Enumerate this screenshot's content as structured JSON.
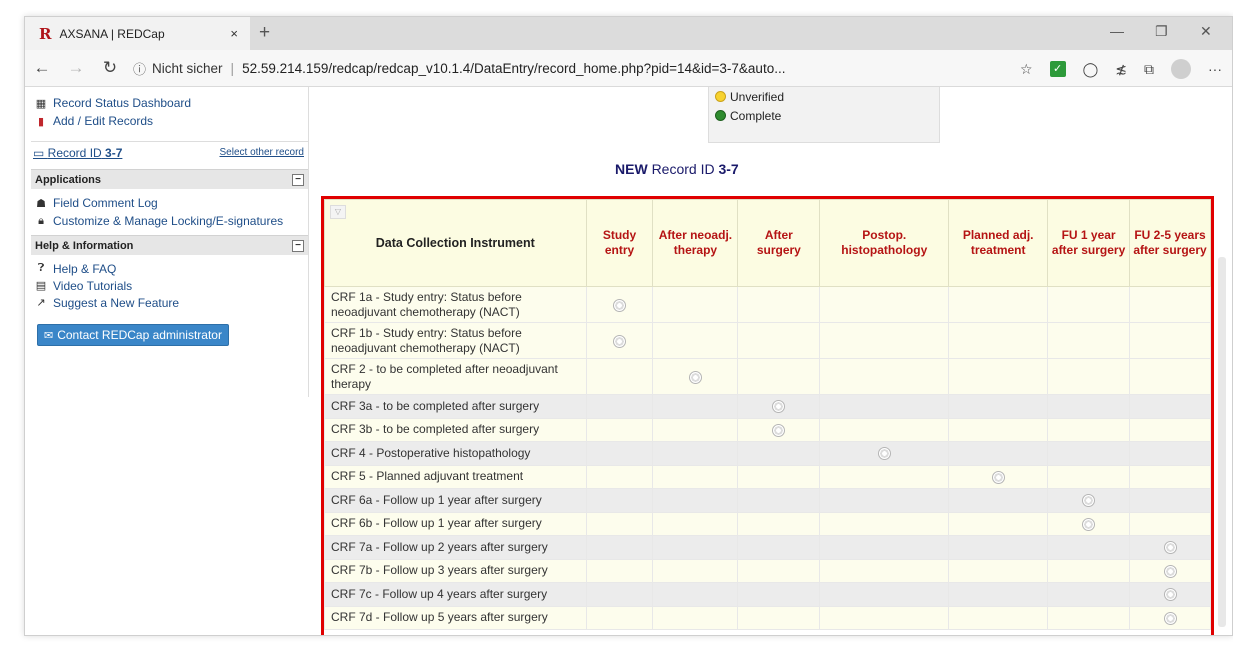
{
  "browser": {
    "tab_logo": "R",
    "tab_title": "AXSANA | REDCap",
    "tab_close": "×",
    "new_tab": "+",
    "insecure_label": "Nicht sicher",
    "url": "52.59.214.159/redcap/redcap_v10.1.4/DataEntry/record_home.php?pid=14&id=3-7&auto..."
  },
  "sidebar": {
    "dashboard": "Record Status Dashboard",
    "add_edit": "Add / Edit Records",
    "record_label": "Record ID",
    "record_id": "3-7",
    "select_other": "Select other record",
    "applications": {
      "header": "Applications",
      "items": [
        "Field Comment Log",
        "Customize & Manage Locking/E-signatures"
      ]
    },
    "help": {
      "header": "Help & Information",
      "items": [
        "Help & FAQ",
        "Video Tutorials",
        "Suggest a New Feature"
      ]
    },
    "contact_button": "Contact REDCap administrator"
  },
  "legend": {
    "unverified": "Unverified",
    "complete": "Complete"
  },
  "record_title": {
    "prefix": "NEW",
    "label": "Record ID",
    "id": "3-7"
  },
  "grid": {
    "instrument_header": "Data Collection Instrument",
    "events": [
      "Study entry",
      "After neoadj. therapy",
      "After surgery",
      "Postop. histopathology",
      "Planned adj. treatment",
      "FU 1 year after surgery",
      "FU 2-5 years after surgery"
    ],
    "rows": [
      {
        "name": "CRF 1a - Study entry: Status before neoadjuvant chemotherapy (NACT)",
        "event_index": 0
      },
      {
        "name": "CRF 1b - Study entry: Status before neoadjuvant chemotherapy (NACT)",
        "event_index": 0
      },
      {
        "name": "CRF 2 - to be completed after neoadjuvant therapy",
        "event_index": 1
      },
      {
        "name": "CRF 3a - to be completed after surgery",
        "event_index": 2
      },
      {
        "name": "CRF 3b - to be completed after surgery",
        "event_index": 2
      },
      {
        "name": "CRF 4 - Postoperative histopathology",
        "event_index": 3
      },
      {
        "name": "CRF 5 - Planned adjuvant treatment",
        "event_index": 4
      },
      {
        "name": "CRF 6a - Follow up 1 year after surgery",
        "event_index": 5
      },
      {
        "name": "CRF 6b - Follow up 1 year after surgery",
        "event_index": 5
      },
      {
        "name": "CRF 7a - Follow up 2 years after surgery",
        "event_index": 6
      },
      {
        "name": "CRF 7b - Follow up 3 years after surgery",
        "event_index": 6
      },
      {
        "name": "CRF 7c - Follow up 4 years after surgery",
        "event_index": 6
      },
      {
        "name": "CRF 7d - Follow up 5 years after surgery",
        "event_index": 6
      }
    ]
  },
  "colors": {
    "highlight_border": "#e00000",
    "event_header_text": "#b51414",
    "link": "#1f4e88",
    "contact_button": "#3a86c8"
  }
}
